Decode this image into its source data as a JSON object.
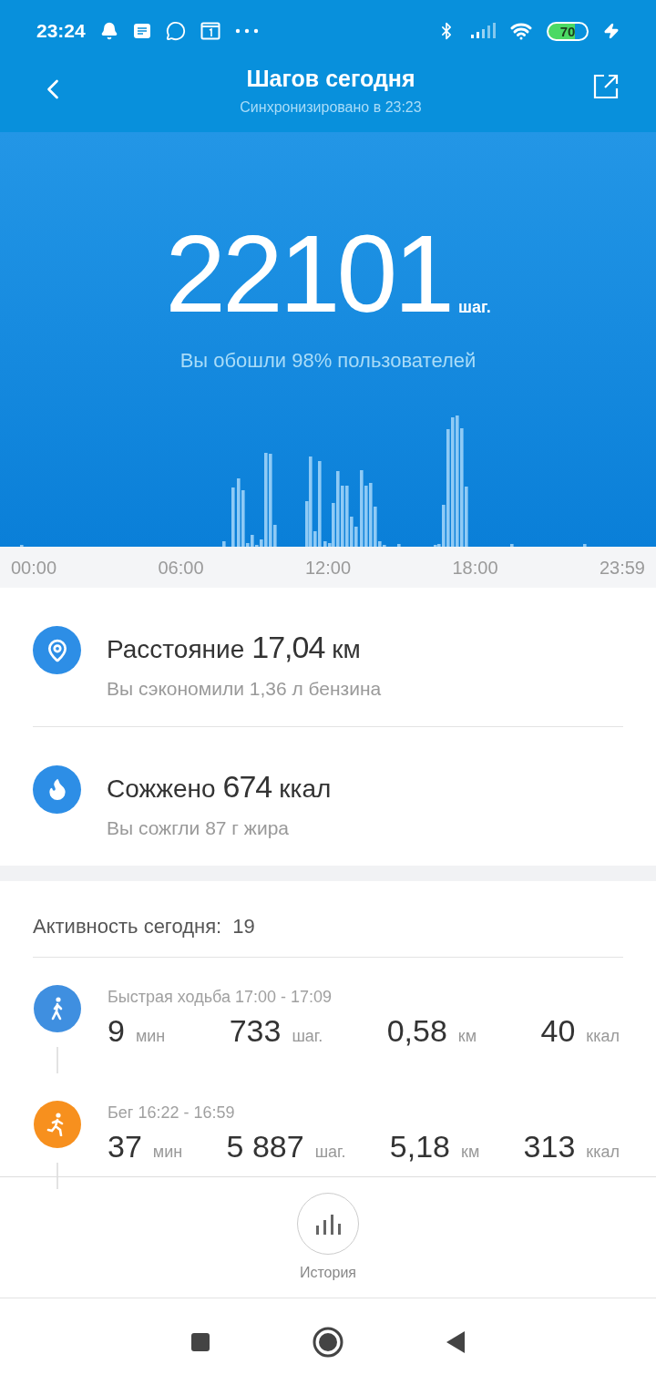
{
  "status_bar": {
    "time": "23:24",
    "battery": "70"
  },
  "header": {
    "title": "Шагов сегодня",
    "subtitle": "Синхронизировано в 23:23"
  },
  "steps": {
    "value": "22101",
    "unit": "шаг.",
    "caption": "Вы обошли 98% пользователей"
  },
  "chart_axis": [
    "00:00",
    "06:00",
    "12:00",
    "18:00",
    "23:59"
  ],
  "stats": [
    {
      "kind": "distance",
      "label": "Расстояние",
      "value": "17,04",
      "unit": "км",
      "note": "Вы сэкономили 1,36 л бензина"
    },
    {
      "kind": "calories",
      "label": "Сожжено",
      "value": "674",
      "unit": "ккал",
      "note": "Вы сожгли 87 г жира"
    }
  ],
  "activity": {
    "label": "Активность сегодня:",
    "count": "19",
    "items": [
      {
        "kind": "walk",
        "title": "Быстрая ходьба 17:00 - 17:09",
        "metrics": [
          {
            "value": "9",
            "unit": "мин"
          },
          {
            "value": "733",
            "unit": "шаг."
          },
          {
            "value": "0,58",
            "unit": "км"
          },
          {
            "value": "40",
            "unit": "ккал"
          }
        ]
      },
      {
        "kind": "run",
        "title": "Бег 16:22 - 16:59",
        "metrics": [
          {
            "value": "37",
            "unit": "мин"
          },
          {
            "value": "5 887",
            "unit": "шаг."
          },
          {
            "value": "5,18",
            "unit": "км"
          },
          {
            "value": "313",
            "unit": "ккал"
          }
        ]
      }
    ]
  },
  "history_button": {
    "label": "История"
  }
}
